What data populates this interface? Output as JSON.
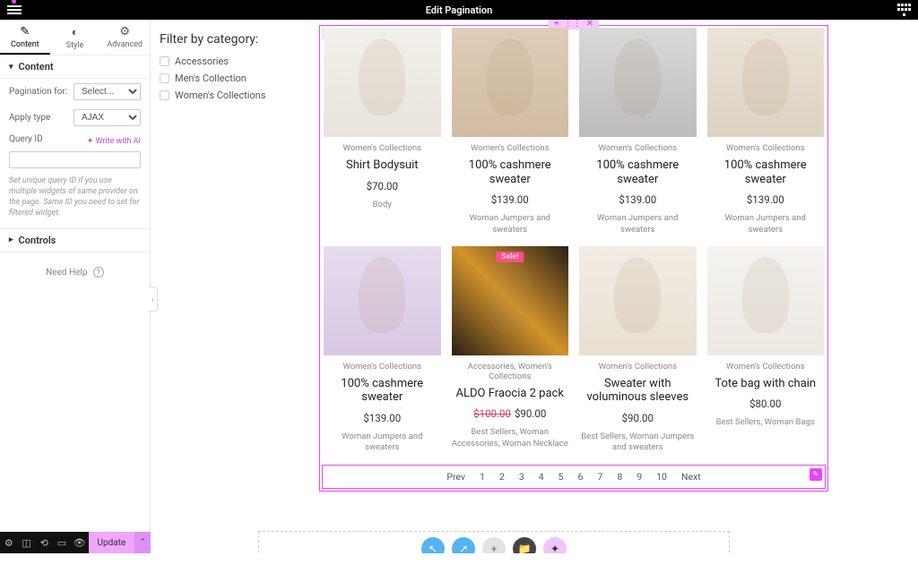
{
  "header": {
    "title": "Edit Pagination"
  },
  "tabs": [
    {
      "label": "Content",
      "icon": "✎"
    },
    {
      "label": "Style",
      "icon": "◐"
    },
    {
      "label": "Advanced",
      "icon": "⚙"
    }
  ],
  "section_content": {
    "title": "Content"
  },
  "fields": {
    "pagination_for": {
      "label": "Pagination for:",
      "value": "Select..."
    },
    "apply_type": {
      "label": "Apply type",
      "value": "AJAX"
    },
    "query_id": {
      "label": "Query ID",
      "ai_label": "✦ Write with AI",
      "value": ""
    },
    "helper": "Set unique query ID if you use multiple widgets of same provider on the page. Same ID you need to set for filtered widget."
  },
  "section_controls": {
    "title": "Controls"
  },
  "need_help": "Need Help",
  "filters": {
    "heading": "Filter by category:",
    "items": [
      "Accessories",
      "Men's Collection",
      "Women's Collections"
    ]
  },
  "products": [
    {
      "img": "white",
      "cat": "Women's Collections",
      "title": "Shirt Bodysuit",
      "price": "$70.00",
      "tags": "Body"
    },
    {
      "img": "tan",
      "cat": "Women's Collections",
      "title": "100% cashmere sweater",
      "price": "$139.00",
      "tags": "Woman Jumpers and sweaters"
    },
    {
      "img": "grey",
      "cat": "Women's Collections",
      "title": "100% cashmere sweater",
      "price": "$139.00",
      "tags": "Woman Jumpers and sweaters"
    },
    {
      "img": "beige",
      "cat": "Women's Collections",
      "title": "100% cashmere sweater",
      "price": "$139.00",
      "tags": "Woman Jumpers and sweaters"
    },
    {
      "img": "lav",
      "cat": "Women's Collections",
      "title": "100% cashmere sweater",
      "price": "$139.00",
      "tags": "Woman Jumpers and sweaters"
    },
    {
      "img": "floral",
      "sale": "Sale!",
      "cat": "Accessories, Women's Collections",
      "title": "ALDO Fraocia 2 pack",
      "old": "$100.00",
      "price": "$90.00",
      "tags": "Best Sellers, Woman Accessories, Woman Necklace"
    },
    {
      "img": "cream",
      "cat": "Women's Collections",
      "title": "Sweater with voluminous sleeves",
      "price": "$90.00",
      "tags": "Best Sellers, Woman Jumpers and sweaters"
    },
    {
      "img": "bag",
      "cat": "Women's Collections",
      "title": "Tote bag with chain",
      "price": "$80.00",
      "tags": "Best Sellers, Woman Bags"
    }
  ],
  "pagination": {
    "prev": "Prev",
    "pages": [
      "1",
      "2",
      "3",
      "4",
      "5",
      "6",
      "7",
      "8",
      "9",
      "10"
    ],
    "next": "Next"
  },
  "update_btn": "Update",
  "colors": {
    "accent": "#e945ff"
  }
}
